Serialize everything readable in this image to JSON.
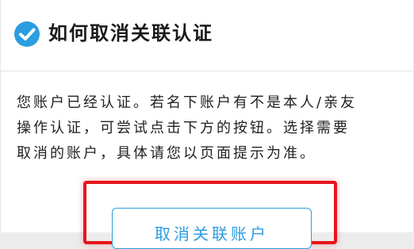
{
  "header": {
    "title": "如何取消关联认证",
    "icon": "check-circle-icon",
    "icon_color": "#2b9de0"
  },
  "description": {
    "lines": [
      "您账户已经认证。若名下账户有不是本人/亲友",
      "操作认证，可尝试点击下方的按钮。选择需要",
      "取消的账户，具体请您以页面提示为准。"
    ]
  },
  "action": {
    "button_label": "取消关联账户",
    "accent_color": "#2b9de0",
    "highlight_color": "#e5161d"
  }
}
